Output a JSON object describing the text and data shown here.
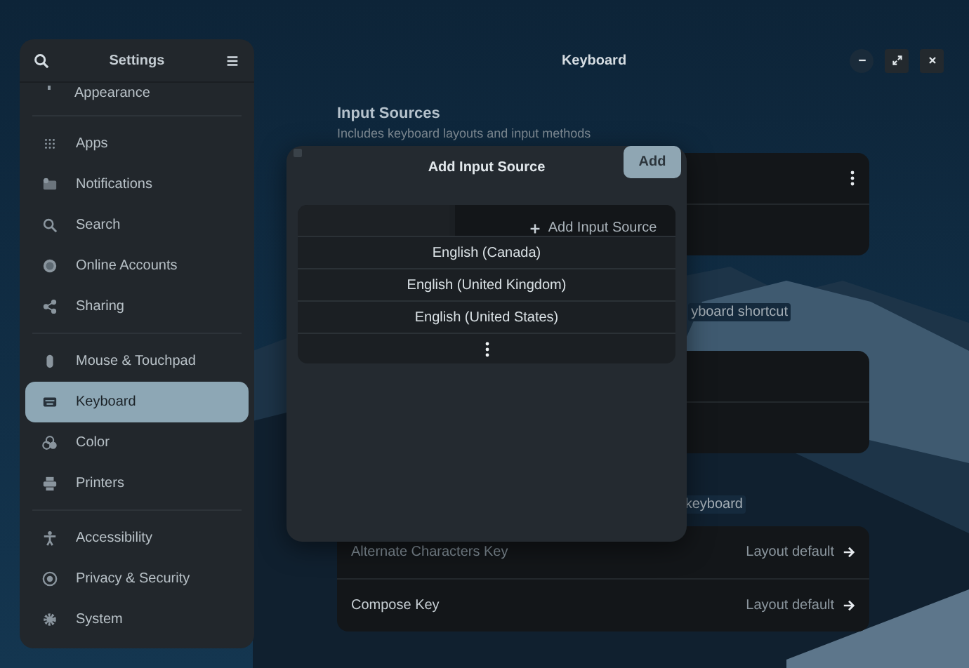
{
  "sidebar": {
    "title": "Settings",
    "groups": [
      [
        {
          "label": "Appearance",
          "kind": "appearance",
          "selected": false
        }
      ],
      [
        {
          "label": "Apps",
          "kind": "apps",
          "selected": false
        },
        {
          "label": "Notifications",
          "kind": "notifications",
          "selected": false
        },
        {
          "label": "Search",
          "kind": "search",
          "selected": false
        },
        {
          "label": "Online Accounts",
          "kind": "accounts",
          "selected": false
        },
        {
          "label": "Sharing",
          "kind": "sharing",
          "selected": false
        }
      ],
      [
        {
          "label": "Mouse & Touchpad",
          "kind": "mouse",
          "selected": false
        },
        {
          "label": "Keyboard",
          "kind": "keyboard",
          "selected": true
        },
        {
          "label": "Color",
          "kind": "color",
          "selected": false
        },
        {
          "label": "Printers",
          "kind": "printers",
          "selected": false
        }
      ],
      [
        {
          "label": "Accessibility",
          "kind": "accessibility",
          "selected": false
        },
        {
          "label": "Privacy & Security",
          "kind": "privacy",
          "selected": false
        },
        {
          "label": "System",
          "kind": "system",
          "selected": false
        }
      ]
    ]
  },
  "window": {
    "title": "Keyboard"
  },
  "input_sources": {
    "title": "Input Sources",
    "description": "Includes keyboard layouts and input methods"
  },
  "shortcut_note": "yboard shortcut",
  "special_note": "keyboard",
  "special_keys": [
    {
      "label": "Alternate Characters Key",
      "value": "Layout default"
    },
    {
      "label": "Compose Key",
      "value": "Layout default"
    }
  ],
  "dialog": {
    "title": "Add Input Source",
    "add_button": "Add",
    "behind_row": "Add Input Source",
    "languages": [
      "English (Canada)",
      "English (United Kingdom)",
      "English (United States)"
    ]
  }
}
